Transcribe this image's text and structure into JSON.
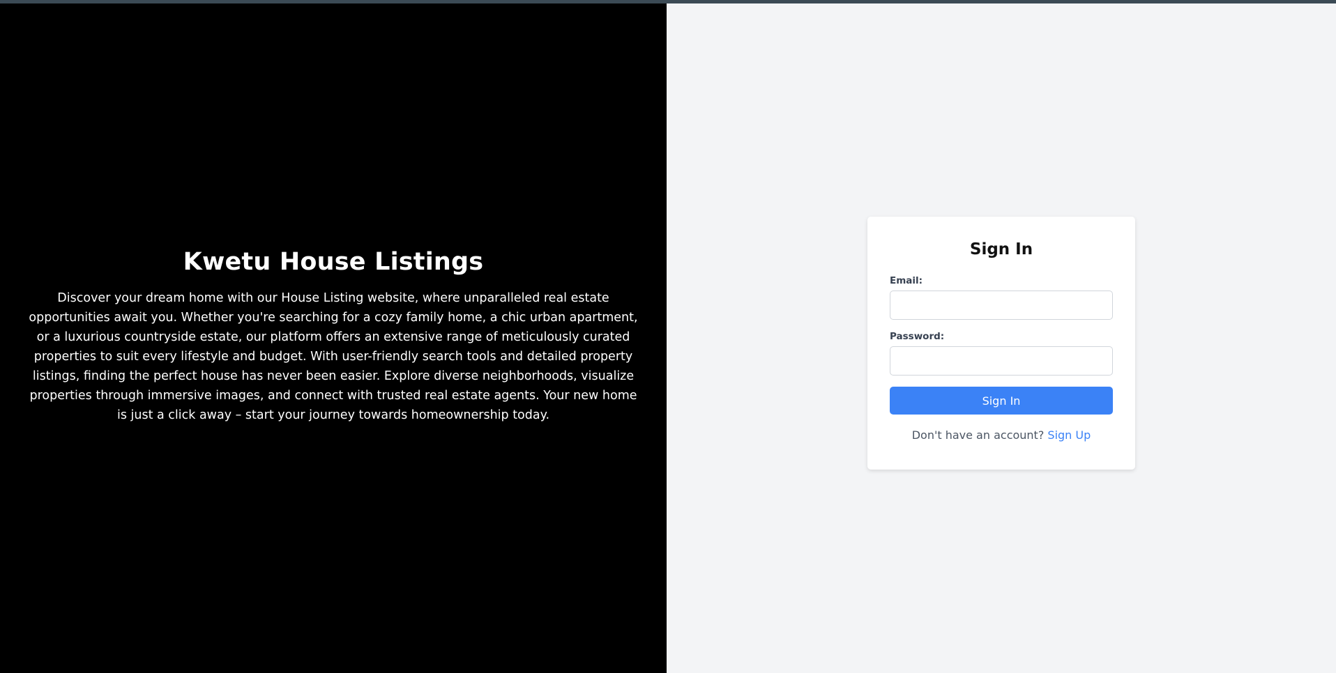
{
  "hero": {
    "title": "Kwetu House Listings",
    "description": "Discover your dream home with our House Listing website, where unparalleled real estate opportunities await you. Whether you're searching for a cozy family home, a chic urban apartment, or a luxurious countryside estate, our platform offers an extensive range of meticulously curated properties to suit every lifestyle and budget. With user-friendly search tools and detailed property listings, finding the perfect house has never been easier. Explore diverse neighborhoods, visualize properties through immersive images, and connect with trusted real estate agents. Your new home is just a click away – start your journey towards homeownership today."
  },
  "signin": {
    "title": "Sign In",
    "email_label": "Email:",
    "email_value": "",
    "password_label": "Password:",
    "password_value": "",
    "submit_label": "Sign In",
    "no_account_text": "Don't have an account?",
    "signup_link": "Sign Up"
  },
  "colors": {
    "hero_bg": "#000000",
    "page_bg": "#f3f4f6",
    "accent": "#3b82f6"
  }
}
